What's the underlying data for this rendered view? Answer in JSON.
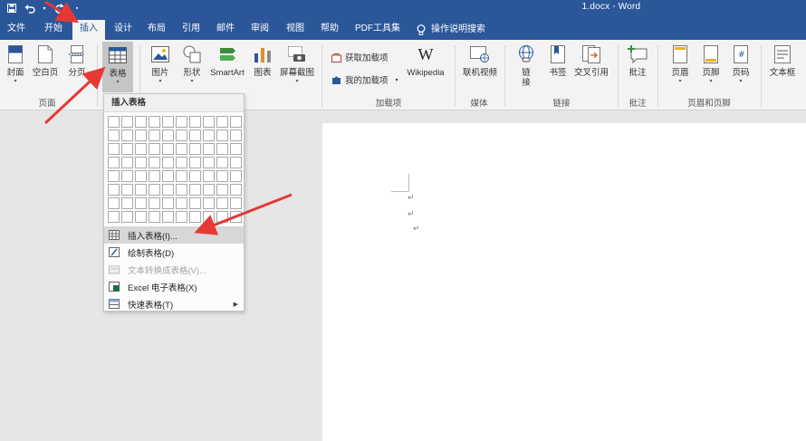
{
  "window": {
    "title": "1.docx - Word"
  },
  "tabs": [
    {
      "label": "文件"
    },
    {
      "label": "开始"
    },
    {
      "label": "插入"
    },
    {
      "label": "设计"
    },
    {
      "label": "布局"
    },
    {
      "label": "引用"
    },
    {
      "label": "邮件"
    },
    {
      "label": "审阅"
    },
    {
      "label": "视图"
    },
    {
      "label": "帮助"
    },
    {
      "label": "PDF工具集"
    },
    {
      "label": "操作说明搜索"
    }
  ],
  "ribbon": {
    "cover": "封面",
    "blank": "空白页",
    "pagebreak": "分页",
    "table": "表格",
    "picture": "图片",
    "shapes": "形状",
    "smartart": "SmartArt",
    "chart": "图表",
    "screenshot": "屏幕截图",
    "get_addins": "获取加载项",
    "my_addins": "我的加载项",
    "wikipedia_glyph": "W",
    "wikipedia": "Wikipedia",
    "online_video": "联机视频",
    "link_line1": "链",
    "link_line2": "接",
    "bookmark": "书签",
    "crossref": "交叉引用",
    "comment": "批注",
    "header": "页眉",
    "footer": "页脚",
    "pagenum": "页码",
    "textbox": "文本框",
    "groups": {
      "pages": "页面",
      "addins": "加载项",
      "media": "媒体",
      "links": "链接",
      "comments": "批注",
      "headerfooter": "页眉和页脚"
    }
  },
  "dropdown": {
    "header": "插入表格",
    "items": [
      {
        "label": "插入表格(I)..."
      },
      {
        "label": "绘制表格(D)"
      },
      {
        "label": "文本转换成表格(V)..."
      },
      {
        "label": "Excel 电子表格(X)"
      },
      {
        "label": "快速表格(T)"
      }
    ]
  },
  "document": {
    "paragraph_mark": "↵"
  },
  "colors": {
    "word_blue": "#2b579a",
    "arrow_red": "#e53935"
  }
}
